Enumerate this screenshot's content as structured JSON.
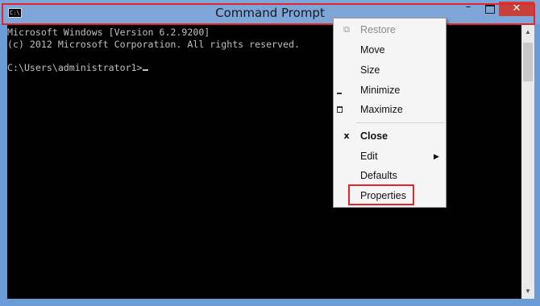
{
  "window": {
    "title": "Command Prompt",
    "icon_text": "C:\\",
    "controls": {
      "minimize": "–",
      "close": "✕"
    }
  },
  "console": {
    "lines": [
      "Microsoft Windows [Version 6.2.9200]",
      "(c) 2012 Microsoft Corporation. All rights reserved.",
      "",
      "C:\\Users\\administrator1>"
    ]
  },
  "context_menu": {
    "restore": "Restore",
    "move": "Move",
    "size": "Size",
    "minimize": "Minimize",
    "maximize": "Maximize",
    "close": "Close",
    "close_icon": "x",
    "edit": "Edit",
    "edit_arrow": "▶",
    "defaults": "Defaults",
    "properties": "Properties"
  },
  "colors": {
    "highlight_border": "#e0262e",
    "console_bg": "#000000",
    "console_text": "#c0c0c0"
  }
}
